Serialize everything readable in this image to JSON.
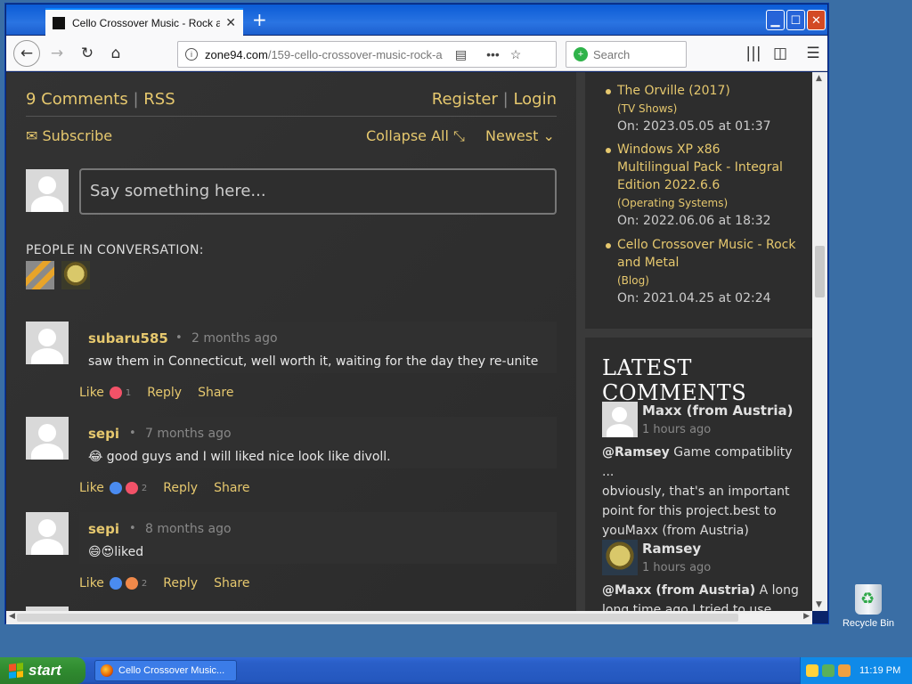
{
  "browser": {
    "tab_title": "Cello Crossover Music - Rock and M",
    "tab_close": "✕",
    "new_tab": "+",
    "url_domain": "zone94.com",
    "url_path": "/159-cello-crossover-music-rock-a",
    "search_placeholder": "Search",
    "window_buttons": {
      "minimize": "▁",
      "maximize": "☐",
      "close": "✕"
    }
  },
  "comments": {
    "count_label": "9 Comments",
    "rss_label": "RSS",
    "register_label": "Register",
    "login_label": "Login",
    "subscribe_label": "Subscribe",
    "collapse_label": "Collapse All",
    "sort_label": "Newest",
    "input_placeholder": "Say something here...",
    "people_label": "PEOPLE IN CONVERSATION:",
    "items": [
      {
        "name": "subaru585",
        "dot": "•",
        "time": "2 months ago",
        "text": "saw them in Connecticut, well worth it, waiting for the day they re-unite",
        "like": "Like",
        "count": "1",
        "reply": "Reply",
        "share": "Share"
      },
      {
        "name": "sepi",
        "dot": "•",
        "time": "7 months ago",
        "text": "😂 good guys and I will liked nice look like divoll.",
        "like": "Like",
        "count": "2",
        "reply": "Reply",
        "share": "Share"
      },
      {
        "name": "sepi",
        "dot": "•",
        "time": "8 months ago",
        "text": "😄😍liked",
        "like": "Like",
        "count": "2",
        "reply": "Reply",
        "share": "Share"
      }
    ]
  },
  "sidebar": {
    "items": [
      {
        "title": "The Orville (2017)",
        "cat": "(TV Shows)",
        "on": "On: 2023.05.05 at 01:37"
      },
      {
        "title_l1": "Windows XP x86",
        "title_l2": "Multilingual Pack - Integral",
        "title_l3": "Edition 2022.6.6",
        "cat": "(Operating Systems)",
        "on": "On: 2022.06.06 at 18:32"
      },
      {
        "title_l1": "Cello Crossover Music - Rock",
        "title_l2": "and Metal",
        "cat": "(Blog)",
        "on": "On: 2021.04.25 at 02:24"
      }
    ],
    "latest_heading": "LATEST COMMENTS",
    "latest": [
      {
        "name": "Maxx (from Austria)",
        "time": "1 hours ago",
        "mention": "@Ramsey",
        "text_l1": " Game compatiblity ...",
        "text_l2": "obviously, that's an important",
        "text_l3": "point for this project.best to",
        "text_l4": "youMaxx (from Austria)"
      },
      {
        "name": "Ramsey",
        "time": "1 hours ago",
        "mention": "@Maxx (from Austria)",
        "text_l1": " A long",
        "text_l2": "long time ago I tried to use"
      }
    ]
  },
  "taskbar": {
    "start_label": "start",
    "task_label": "Cello Crossover Music...",
    "clock": "11:19 PM"
  },
  "desktop": {
    "recycle_label": "Recycle Bin"
  },
  "colors": {
    "accent": "#e6c86e",
    "page_bg": "#2a2a2a",
    "taskbar": "#2457be",
    "start": "#2f8a2f"
  }
}
